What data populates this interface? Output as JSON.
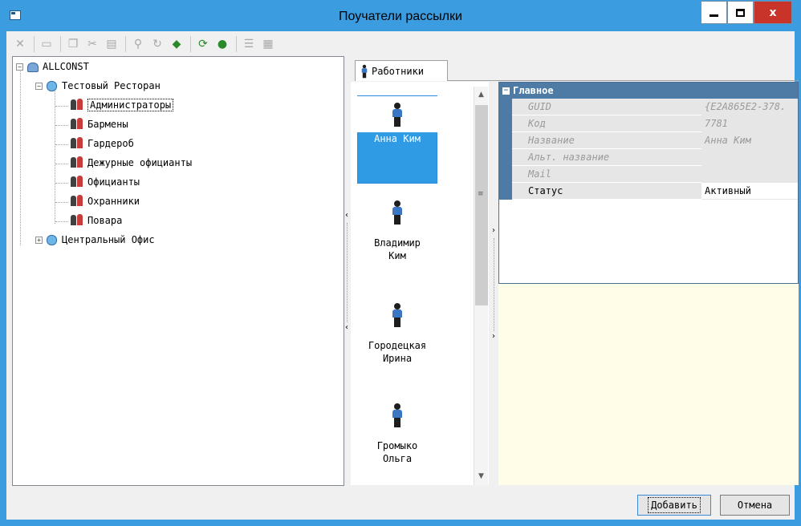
{
  "window": {
    "title": "Поучатели рассылки",
    "close_label": "x"
  },
  "toolbar": {
    "buttons": [
      {
        "name": "delete",
        "glyph": "✕"
      },
      {
        "name": "save",
        "glyph": "▭"
      },
      {
        "name": "copy",
        "glyph": "❐"
      },
      {
        "name": "cut",
        "glyph": "✂"
      },
      {
        "name": "paste",
        "glyph": "▤"
      },
      {
        "name": "find",
        "glyph": "⚲"
      },
      {
        "name": "move",
        "glyph": "↻"
      },
      {
        "name": "import",
        "glyph": "◆"
      },
      {
        "name": "refresh",
        "glyph": "⟳"
      },
      {
        "name": "sync",
        "glyph": "●"
      },
      {
        "name": "list",
        "glyph": "☰"
      },
      {
        "name": "export",
        "glyph": "▦"
      }
    ]
  },
  "tree": {
    "root": "ALLCONST",
    "restaurant": "Тестовый Ресторан",
    "groups": [
      "Администраторы",
      "Бармены",
      "Гардероб",
      "Дежурные официанты",
      "Официанты",
      "Охранники",
      "Повара"
    ],
    "office": "Центральный Офис",
    "expanded_glyph": "−",
    "collapsed_glyph": "+"
  },
  "tab": {
    "label": "Работники"
  },
  "employees": [
    {
      "line1": "Анна Ким",
      "line2": ""
    },
    {
      "line1": "Владимир",
      "line2": "Ким"
    },
    {
      "line1": "Городецкая",
      "line2": "Ирина"
    },
    {
      "line1": "Громыко",
      "line2": "Ольга"
    }
  ],
  "properties": {
    "section": "Главное",
    "rows": [
      {
        "name": "GUID",
        "value": "{E2A865E2-378."
      },
      {
        "name": "Код",
        "value": "7781"
      },
      {
        "name": "Название",
        "value": "Анна Ким"
      },
      {
        "name": "Альт. название",
        "value": ""
      },
      {
        "name": "Mail",
        "value": ""
      },
      {
        "name": "Статус",
        "value": "Активный"
      }
    ]
  },
  "buttons": {
    "add": "Добавить",
    "cancel": "Отмена"
  }
}
